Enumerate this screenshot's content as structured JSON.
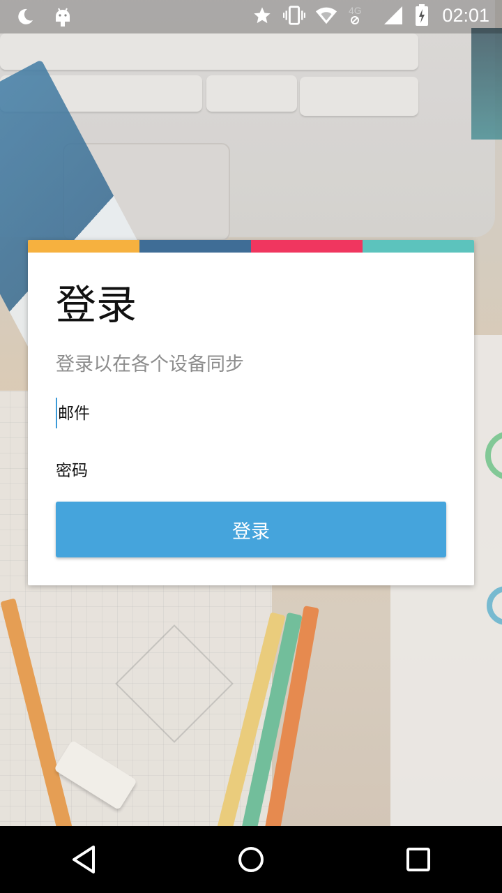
{
  "status_bar": {
    "time": "02:01",
    "network": "4G",
    "icons": [
      "moon-icon",
      "android-icon",
      "star-icon",
      "vibrate-icon",
      "wifi-icon",
      "signal-icon",
      "battery-icon"
    ]
  },
  "card": {
    "stripe_colors": [
      "#f6b13f",
      "#3f6d96",
      "#f0365f",
      "#5cc3bd"
    ],
    "title": "登录",
    "subtitle": "登录以在各个设备同步",
    "email_placeholder": "邮件",
    "password_placeholder": "密码",
    "login_button": "登录"
  },
  "colors": {
    "button": "#45a4dc",
    "cursor": "#3c9ad8"
  },
  "nav_bar": {
    "icons": [
      "back-icon",
      "home-icon",
      "recents-icon"
    ]
  }
}
